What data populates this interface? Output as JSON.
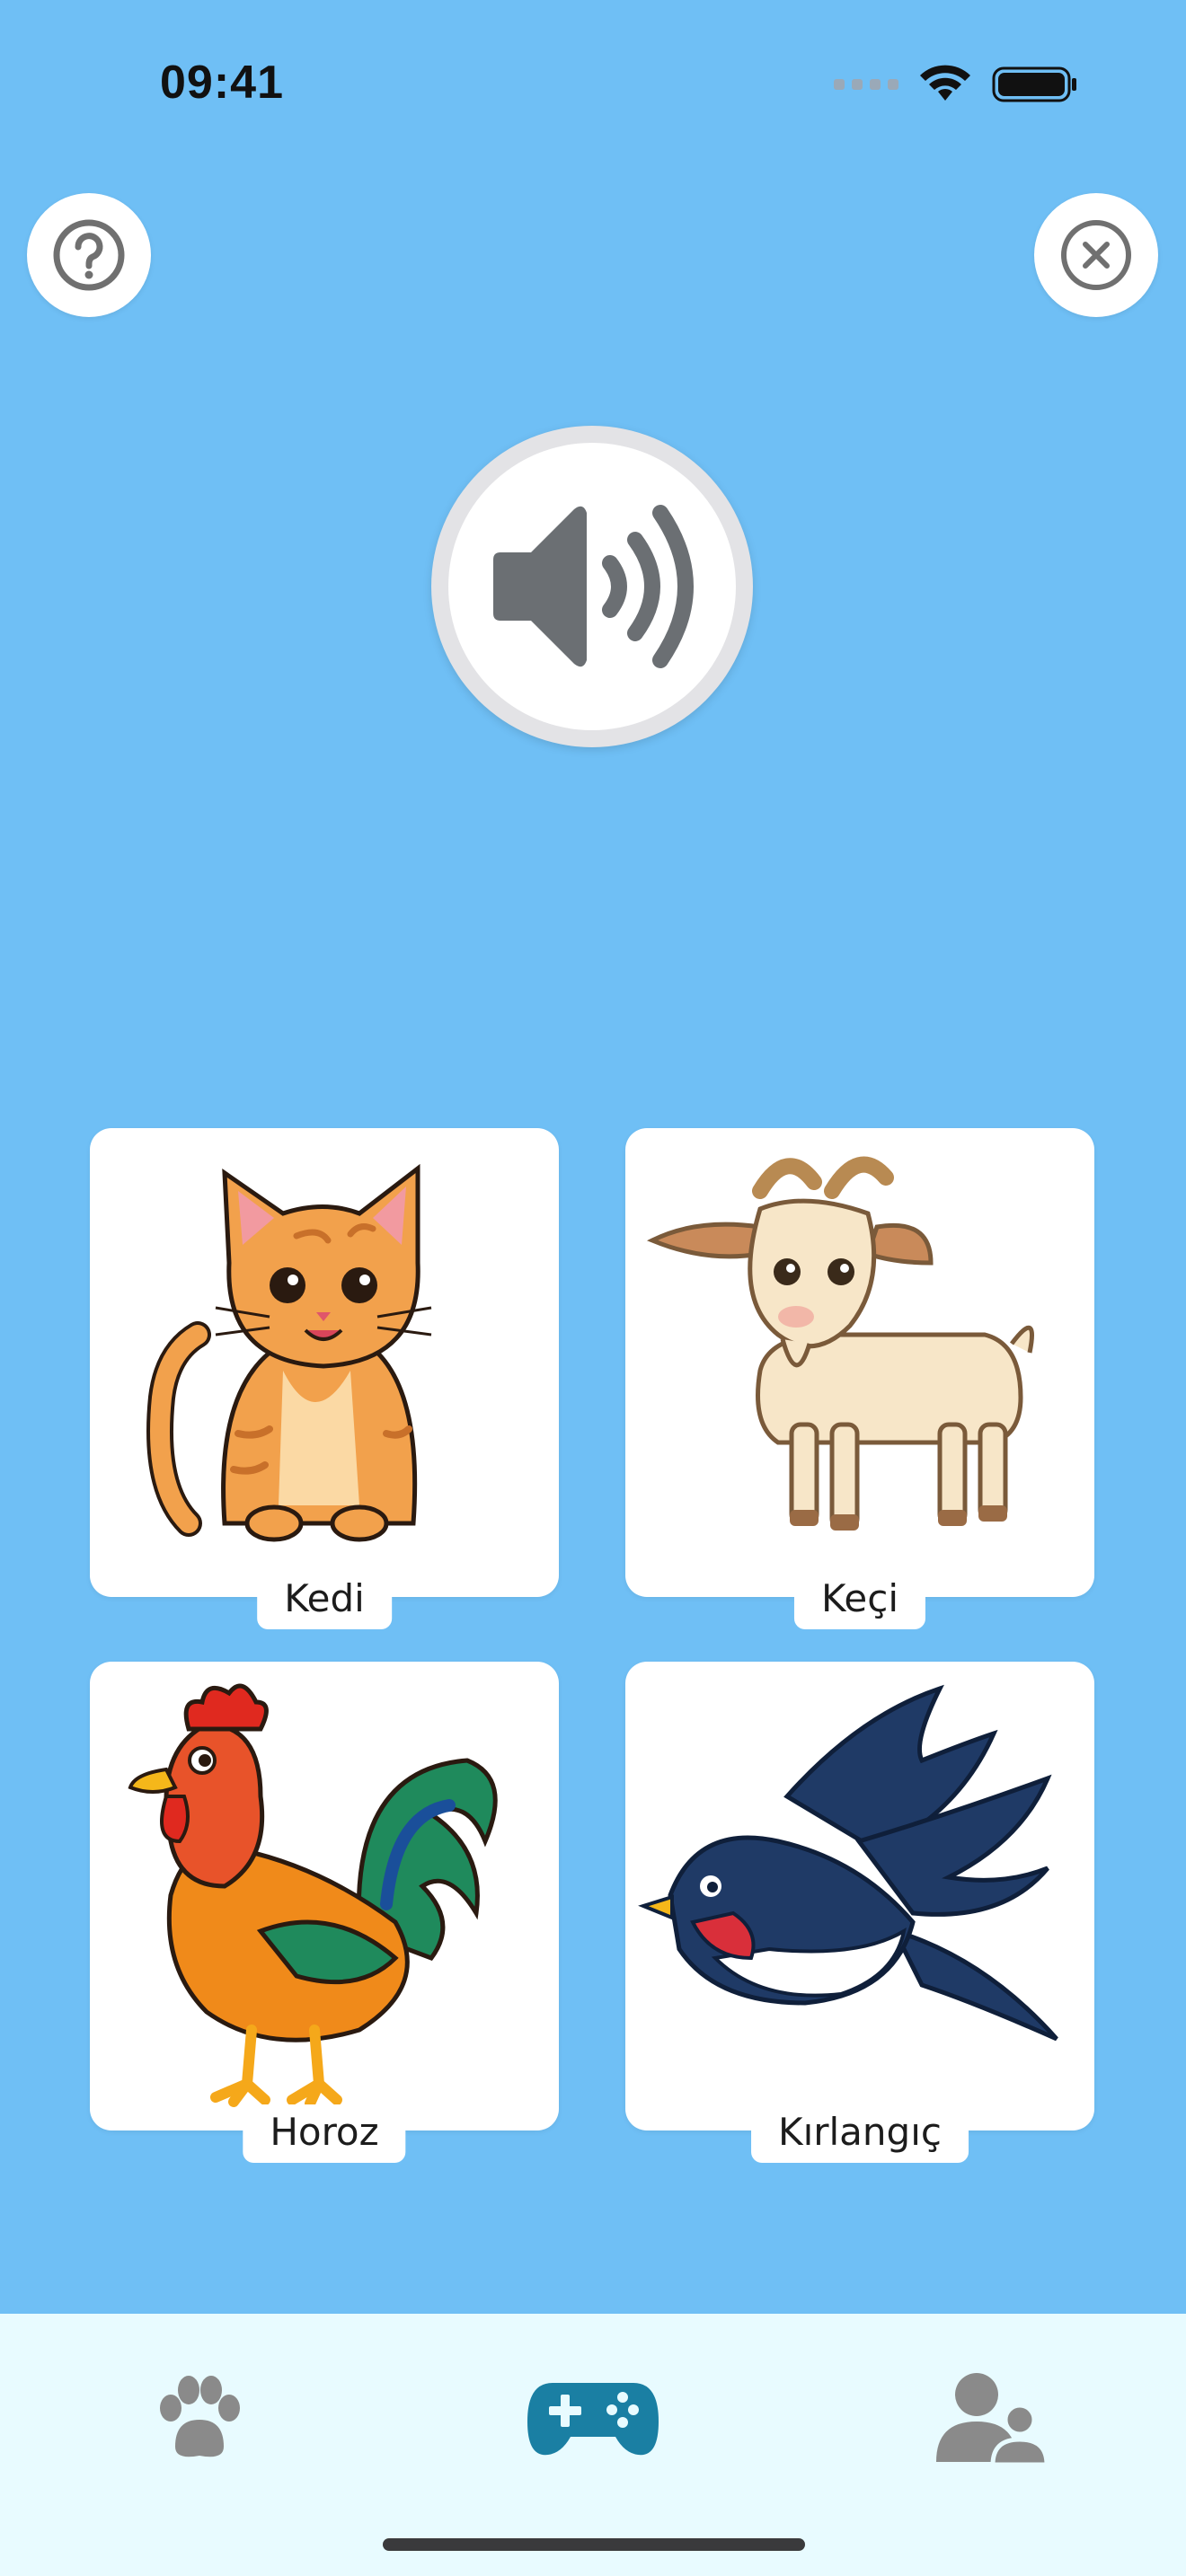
{
  "status_bar": {
    "time": "09:41"
  },
  "top_buttons": {
    "help_icon": "question-circle-icon",
    "close_icon": "close-circle-icon"
  },
  "sound_button": {
    "icon": "speaker-volume-icon"
  },
  "cards": [
    {
      "label": "Kedi",
      "icon": "cat-illustration"
    },
    {
      "label": "Keçi",
      "icon": "goat-illustration"
    },
    {
      "label": "Horoz",
      "icon": "rooster-illustration"
    },
    {
      "label": "Kırlangıç",
      "icon": "swallow-illustration"
    }
  ],
  "tab_bar": {
    "tabs": [
      {
        "icon": "paw-icon",
        "active": false
      },
      {
        "icon": "gamepad-icon",
        "active": true
      },
      {
        "icon": "users-icon",
        "active": false
      }
    ],
    "active_color": "#1a7fa3",
    "inactive_color": "#8a8a8a"
  },
  "colors": {
    "background": "#6fbff5",
    "card": "#ffffff",
    "tabbar": "#e8fbff"
  }
}
